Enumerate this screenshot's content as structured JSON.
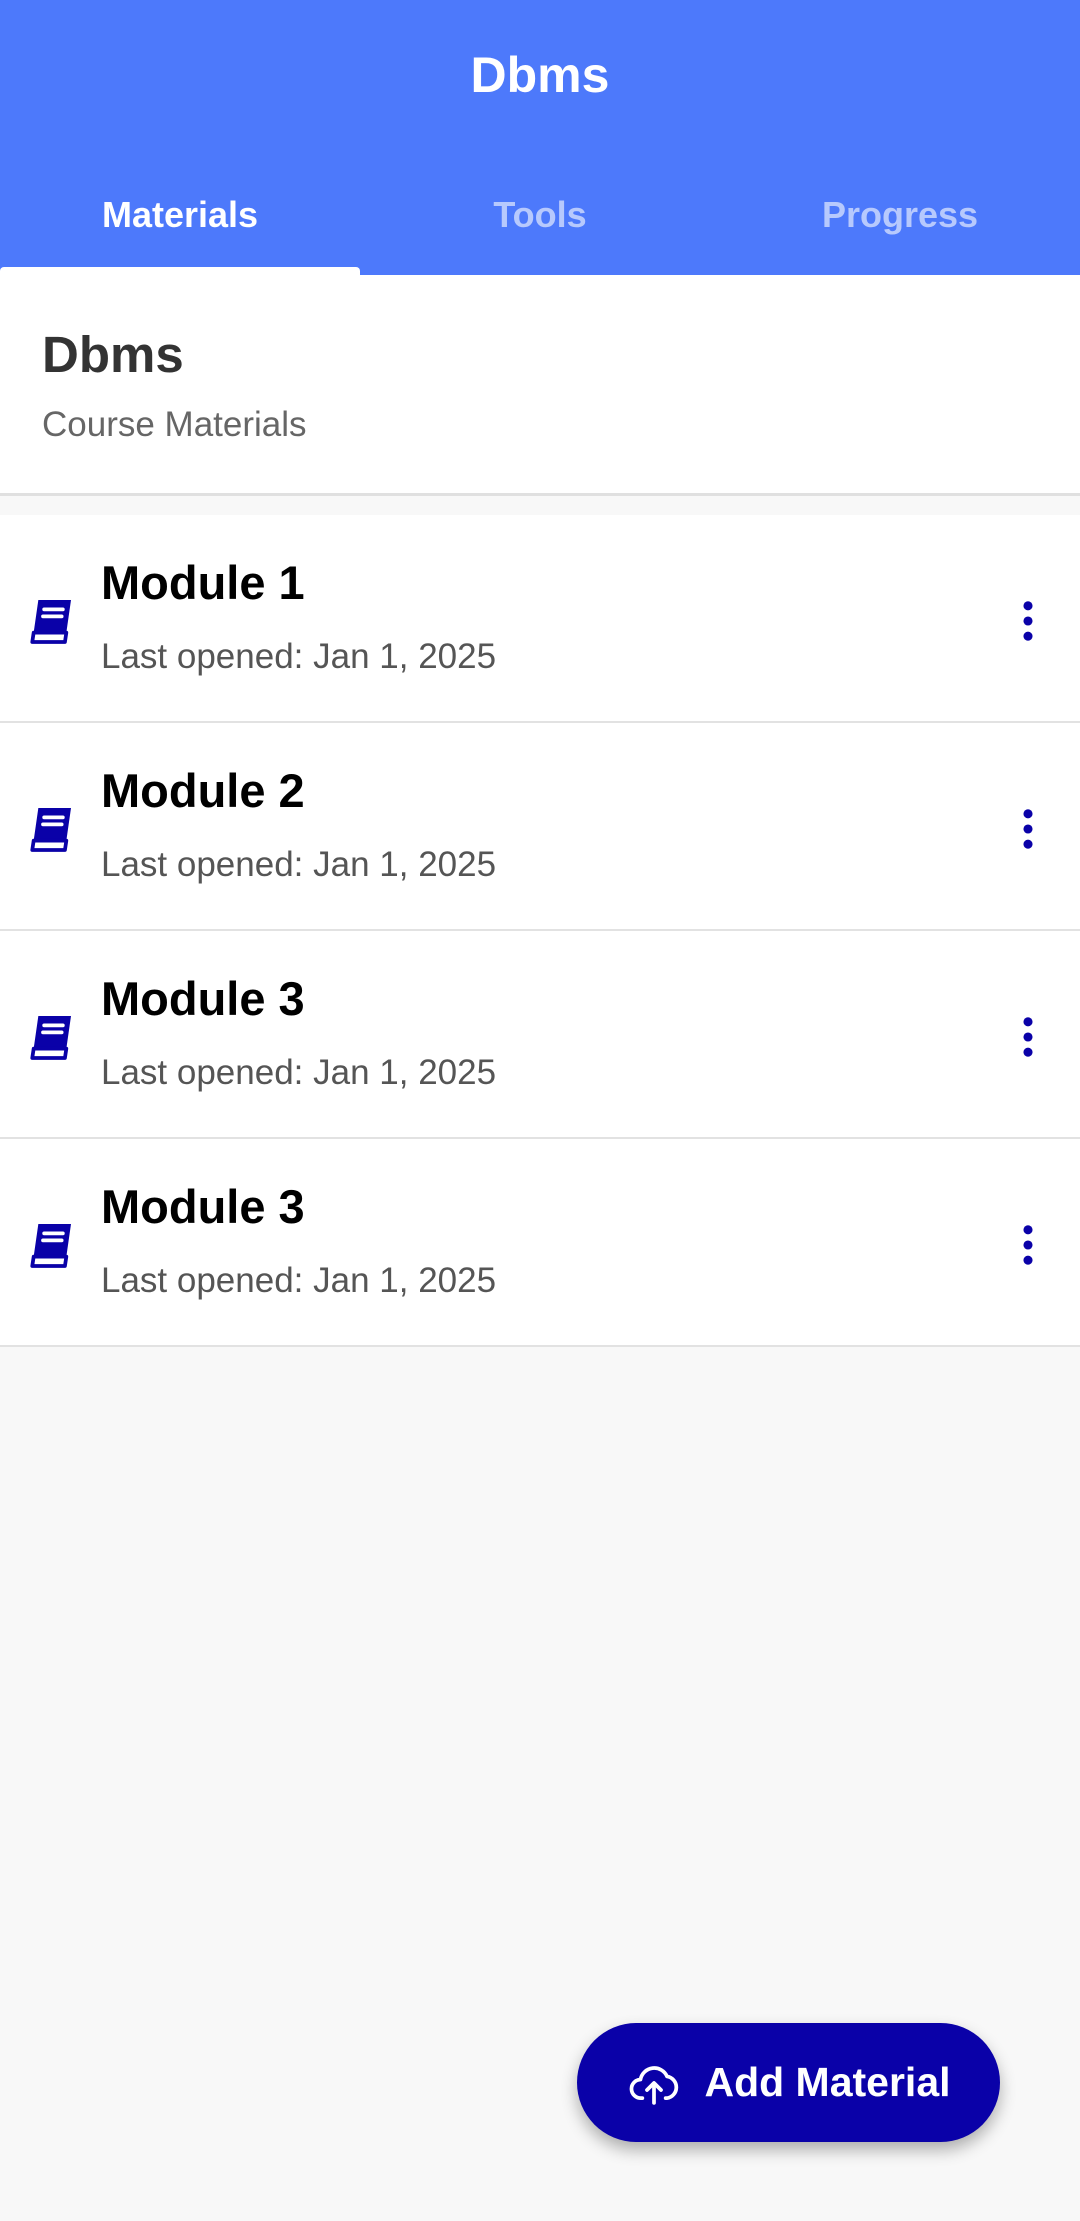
{
  "app_bar": {
    "title": "Dbms",
    "color": "#4d79fb"
  },
  "tabs": [
    {
      "label": "Materials",
      "active": true
    },
    {
      "label": "Tools",
      "active": false
    },
    {
      "label": "Progress",
      "active": false
    }
  ],
  "header": {
    "title": "Dbms",
    "subtitle": "Course Materials"
  },
  "modules": [
    {
      "title": "Module 1",
      "subtitle": "Last opened: Jan 1, 2025",
      "icon": "book-icon",
      "menu_icon": "more-vert-icon"
    },
    {
      "title": "Module 2",
      "subtitle": "Last opened: Jan 1, 2025",
      "icon": "book-icon",
      "menu_icon": "more-vert-icon"
    },
    {
      "title": "Module 3",
      "subtitle": "Last opened: Jan 1, 2025",
      "icon": "book-icon",
      "menu_icon": "more-vert-icon"
    },
    {
      "title": "Module 3",
      "subtitle": "Last opened: Jan 1, 2025",
      "icon": "book-icon",
      "menu_icon": "more-vert-icon"
    }
  ],
  "fab": {
    "label": "Add Material",
    "icon": "cloud-upload-icon",
    "color": "#0a01a8"
  },
  "colors": {
    "accent": "#0a01a8",
    "primary": "#4d79fb"
  }
}
